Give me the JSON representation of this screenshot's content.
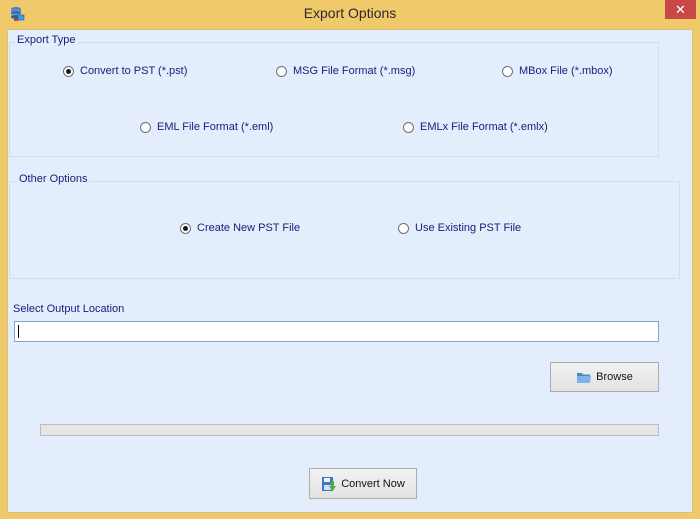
{
  "window": {
    "title": "Export Options",
    "close_label": "✕"
  },
  "export_type": {
    "label": "Export Type",
    "options": [
      {
        "label": "Convert to PST (*.pst)",
        "checked": true
      },
      {
        "label": "MSG File Format (*.msg)",
        "checked": false
      },
      {
        "label": "MBox File (*.mbox)",
        "checked": false
      },
      {
        "label": "EML File Format (*.eml)",
        "checked": false
      },
      {
        "label": "EMLx File Format (*.emlx)",
        "checked": false
      }
    ]
  },
  "other_options": {
    "label": "Other Options",
    "options": [
      {
        "label": "Create  New  PST  File",
        "checked": true
      },
      {
        "label": "Use Existing PST File",
        "checked": false
      }
    ]
  },
  "output": {
    "label": "Select Output Location",
    "value": "",
    "browse_label": "Browse"
  },
  "progress": {
    "percent": 0
  },
  "convert_label": "Convert Now",
  "colors": {
    "title_bar": "#f0c96b",
    "close_button": "#c9484a",
    "client_bg": "#e3edfc",
    "label_text": "#1e1a7a"
  }
}
